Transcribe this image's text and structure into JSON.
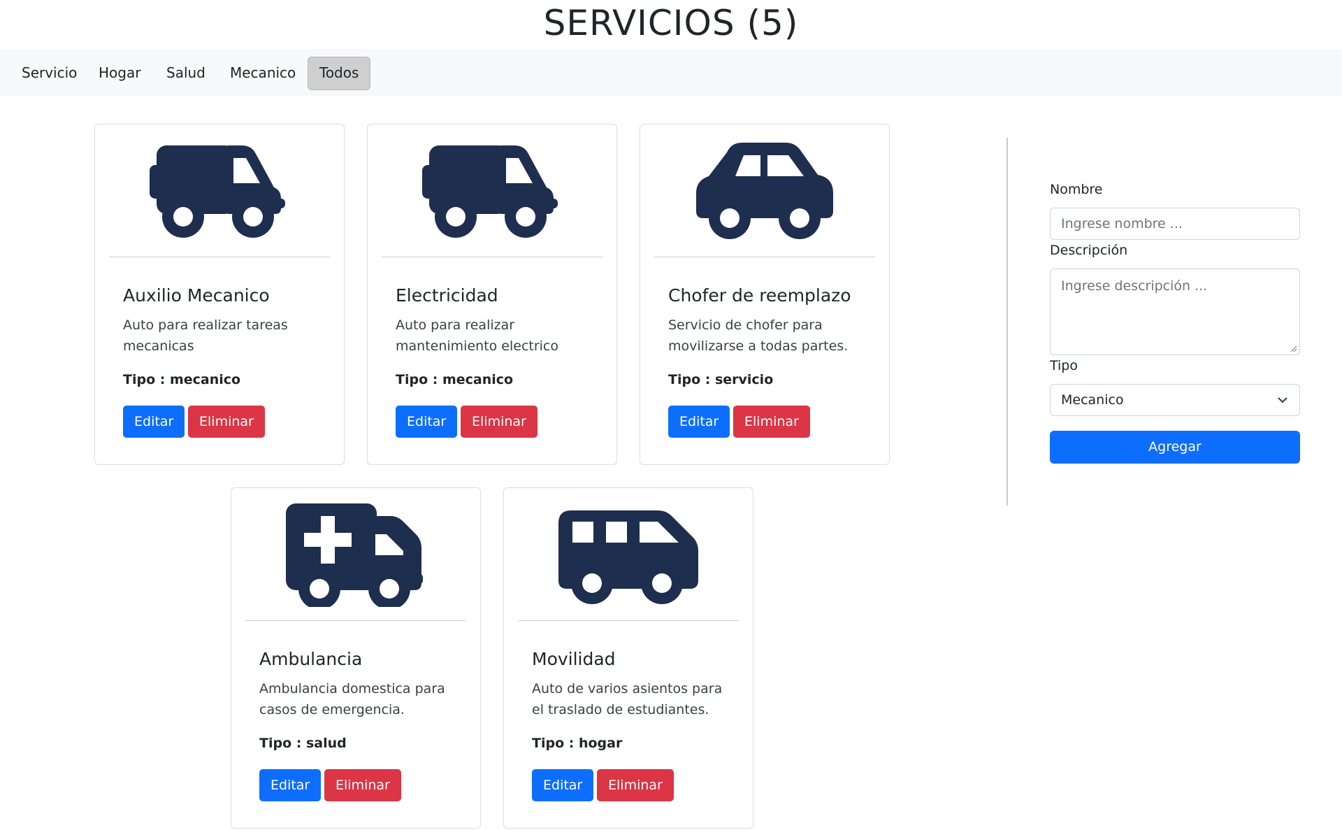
{
  "page": {
    "title": "SERVICIOS (5)"
  },
  "navbar": {
    "items": [
      {
        "label": "Servicio"
      },
      {
        "label": "Hogar"
      },
      {
        "label": "Salud"
      },
      {
        "label": "Mecanico"
      },
      {
        "label": "Todos",
        "active": true
      }
    ]
  },
  "cards": [
    {
      "icon": "truck-icon",
      "title": "Auxilio Mecanico",
      "description": "Auto para realizar tareas mecanicas",
      "type": "Tipo : mecanico",
      "edit_label": "Editar",
      "delete_label": "Eliminar"
    },
    {
      "icon": "truck-icon",
      "title": "Electricidad",
      "description": "Auto para realizar mantenimiento electrico",
      "type": "Tipo : mecanico",
      "edit_label": "Editar",
      "delete_label": "Eliminar"
    },
    {
      "icon": "car-icon",
      "title": "Chofer de reemplazo",
      "description": "Servicio de chofer para movilizarse a todas partes.",
      "type": "Tipo : servicio",
      "edit_label": "Editar",
      "delete_label": "Eliminar"
    },
    {
      "icon": "ambulance-icon",
      "title": "Ambulancia",
      "description": "Ambulancia domestica para casos de emergencia.",
      "type": "Tipo : salud",
      "edit_label": "Editar",
      "delete_label": "Eliminar"
    },
    {
      "icon": "van-icon",
      "title": "Movilidad",
      "description": "Auto de varios asientos para el traslado de estudiantes.",
      "type": "Tipo : hogar",
      "edit_label": "Editar",
      "delete_label": "Eliminar"
    }
  ],
  "form": {
    "nombre_label": "Nombre",
    "nombre_placeholder": "Ingrese nombre ...",
    "descripcion_label": "Descripción",
    "descripcion_placeholder": "Ingrese descripción ...",
    "tipo_label": "Tipo",
    "tipo_selected": "Mecanico",
    "submit_label": "Agregar"
  },
  "colors": {
    "icon": "#1e2e4f",
    "primary": "#0d6efd",
    "danger": "#dc3545",
    "navbar_bg": "#f8f9fa",
    "active_tab_bg": "#cfcfcf"
  }
}
